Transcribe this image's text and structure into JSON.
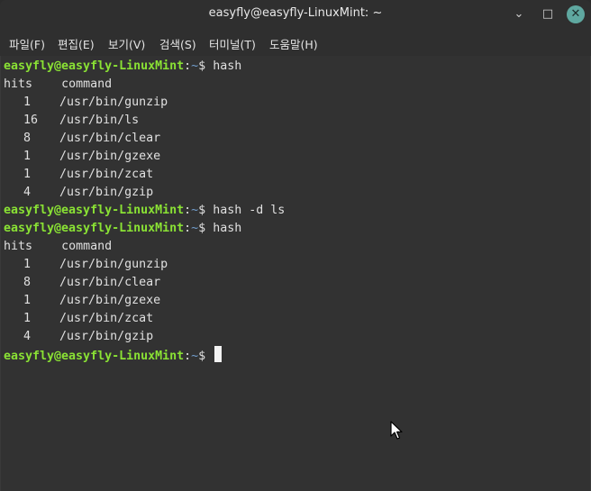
{
  "window": {
    "title": "easyfly@easyfly-LinuxMint: ~",
    "minimize": "⌄",
    "maximize": "□",
    "close": "✕"
  },
  "menu": [
    "파일(F)",
    "편집(E)",
    "보기(V)",
    "검색(S)",
    "터미널(T)",
    "도움말(H)"
  ],
  "terminal": {
    "prompt_user": "easyfly@easyfly-LinuxMint",
    "prompt_sep": ":",
    "prompt_path": "~",
    "prompt_end": "$ ",
    "commands": [
      "hash",
      "hash -d ls",
      "hash",
      ""
    ],
    "table_header": {
      "hits": "hits",
      "command": "command"
    },
    "first_output": [
      {
        "hits": "1",
        "command": "/usr/bin/gunzip"
      },
      {
        "hits": "16",
        "command": "/usr/bin/ls"
      },
      {
        "hits": "8",
        "command": "/usr/bin/clear"
      },
      {
        "hits": "1",
        "command": "/usr/bin/gzexe"
      },
      {
        "hits": "1",
        "command": "/usr/bin/zcat"
      },
      {
        "hits": "4",
        "command": "/usr/bin/gzip"
      }
    ],
    "second_output": [
      {
        "hits": "1",
        "command": "/usr/bin/gunzip"
      },
      {
        "hits": "8",
        "command": "/usr/bin/clear"
      },
      {
        "hits": "1",
        "command": "/usr/bin/gzexe"
      },
      {
        "hits": "1",
        "command": "/usr/bin/zcat"
      },
      {
        "hits": "4",
        "command": "/usr/bin/gzip"
      }
    ]
  }
}
